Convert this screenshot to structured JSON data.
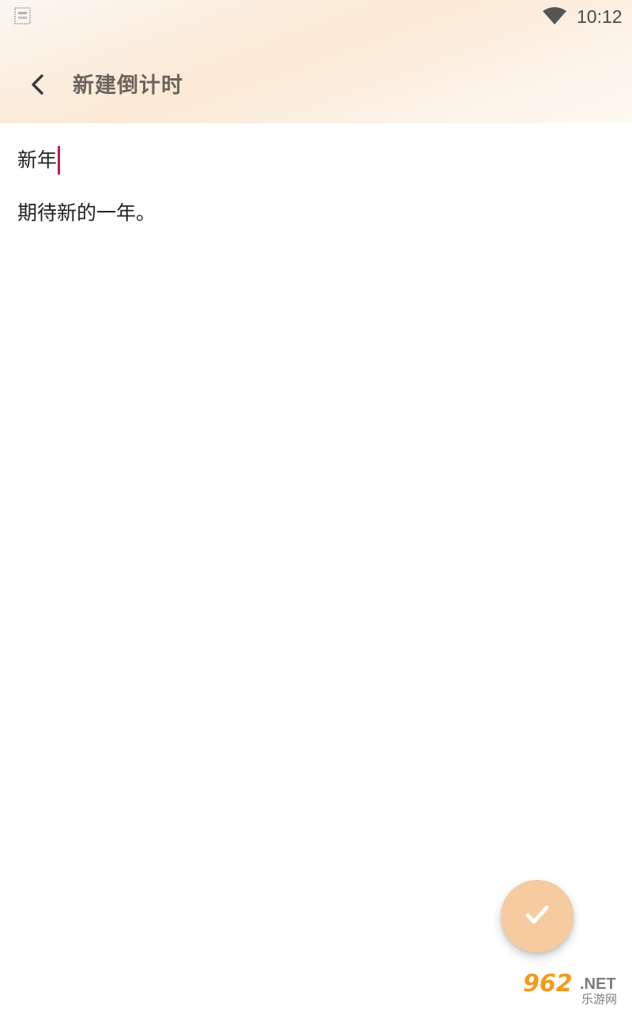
{
  "status_bar": {
    "time": "10:12"
  },
  "header": {
    "title": "新建倒计时"
  },
  "form": {
    "title_value": "新年",
    "description_value": "期待新的一年。"
  },
  "watermark": {
    "number": "962",
    "net": ".NET",
    "cn": "乐游网"
  },
  "colors": {
    "accent": "#f5cb9f",
    "caret": "#c2185b",
    "title_text": "#6b645d"
  },
  "icons": {
    "back": "back-arrow-icon",
    "confirm": "checkmark-icon",
    "wifi": "wifi-icon"
  }
}
